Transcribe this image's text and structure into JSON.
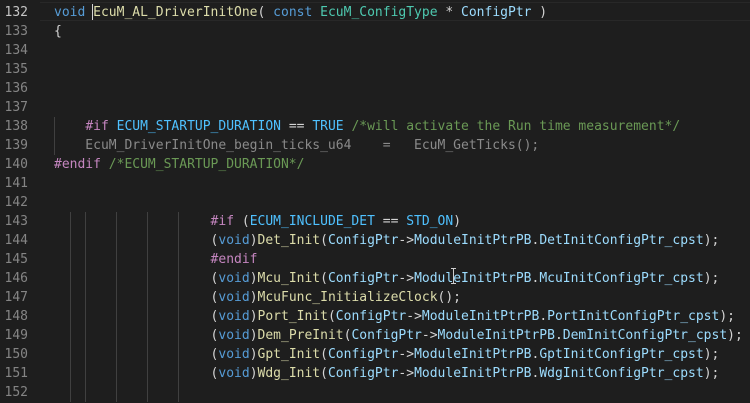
{
  "editor": {
    "active_line": "132",
    "lines": [
      {
        "num": "132",
        "tokens": [
          {
            "t": "void",
            "c": "kw"
          },
          {
            "t": " ",
            "c": "plain"
          },
          {
            "t": "EcuM_AL_DriverInitOne",
            "c": "fn"
          },
          {
            "t": "( ",
            "c": "plain"
          },
          {
            "t": "const",
            "c": "kw"
          },
          {
            "t": " ",
            "c": "plain"
          },
          {
            "t": "EcuM_ConfigType",
            "c": "ty"
          },
          {
            "t": " * ",
            "c": "plain"
          },
          {
            "t": "ConfigPtr",
            "c": "pm"
          },
          {
            "t": " )",
            "c": "plain"
          }
        ]
      },
      {
        "num": "133",
        "tokens": [
          {
            "t": "{",
            "c": "plain"
          }
        ]
      },
      {
        "num": "134",
        "tokens": []
      },
      {
        "num": "135",
        "tokens": []
      },
      {
        "num": "136",
        "tokens": []
      },
      {
        "num": "137",
        "tokens": []
      },
      {
        "num": "138",
        "tokens": [
          {
            "t": "    ",
            "c": "plain"
          },
          {
            "t": "#if",
            "c": "pp"
          },
          {
            "t": " ",
            "c": "plain"
          },
          {
            "t": "ECUM_STARTUP_DURATION",
            "c": "mac"
          },
          {
            "t": " == ",
            "c": "plain"
          },
          {
            "t": "TRUE",
            "c": "mac"
          },
          {
            "t": " ",
            "c": "plain"
          },
          {
            "t": "/*will activate the Run time measurement*/",
            "c": "cm"
          }
        ]
      },
      {
        "num": "139",
        "tokens": [
          {
            "t": "    EcuM_DriverInitOne_begin_ticks_u64    =   EcuM_GetTicks();",
            "c": "inact"
          }
        ]
      },
      {
        "num": "140",
        "tokens": [
          {
            "t": "#endif",
            "c": "pp"
          },
          {
            "t": " ",
            "c": "plain"
          },
          {
            "t": "/*ECUM_STARTUP_DURATION*/",
            "c": "cm"
          }
        ]
      },
      {
        "num": "141",
        "tokens": []
      },
      {
        "num": "142",
        "tokens": []
      },
      {
        "num": "143",
        "tokens": [
          {
            "t": "                    ",
            "c": "plain"
          },
          {
            "t": "#if",
            "c": "pp"
          },
          {
            "t": " (",
            "c": "plain"
          },
          {
            "t": "ECUM_INCLUDE_DET",
            "c": "mac"
          },
          {
            "t": " == ",
            "c": "plain"
          },
          {
            "t": "STD_ON",
            "c": "mac"
          },
          {
            "t": ")",
            "c": "plain"
          }
        ]
      },
      {
        "num": "144",
        "tokens": [
          {
            "t": "                    (",
            "c": "plain"
          },
          {
            "t": "void",
            "c": "kw"
          },
          {
            "t": ")",
            "c": "plain"
          },
          {
            "t": "Det_Init",
            "c": "fn"
          },
          {
            "t": "(",
            "c": "plain"
          },
          {
            "t": "ConfigPtr",
            "c": "pm"
          },
          {
            "t": "->",
            "c": "plain"
          },
          {
            "t": "ModuleInitPtrPB",
            "c": "pm"
          },
          {
            "t": ".",
            "c": "plain"
          },
          {
            "t": "DetInitConfigPtr_cpst",
            "c": "pm"
          },
          {
            "t": ");",
            "c": "plain"
          }
        ]
      },
      {
        "num": "145",
        "tokens": [
          {
            "t": "                    ",
            "c": "plain"
          },
          {
            "t": "#endif",
            "c": "pp"
          }
        ]
      },
      {
        "num": "146",
        "tokens": [
          {
            "t": "                    (",
            "c": "plain"
          },
          {
            "t": "void",
            "c": "kw"
          },
          {
            "t": ")",
            "c": "plain"
          },
          {
            "t": "Mcu_Init",
            "c": "fn"
          },
          {
            "t": "(",
            "c": "plain"
          },
          {
            "t": "ConfigPtr",
            "c": "pm"
          },
          {
            "t": "->",
            "c": "plain"
          },
          {
            "t": "ModuleInitPtrPB",
            "c": "pm"
          },
          {
            "t": ".",
            "c": "plain"
          },
          {
            "t": "McuInitConfigPtr_cpst",
            "c": "pm"
          },
          {
            "t": ");",
            "c": "plain"
          }
        ]
      },
      {
        "num": "147",
        "tokens": [
          {
            "t": "                    (",
            "c": "plain"
          },
          {
            "t": "void",
            "c": "kw"
          },
          {
            "t": ")",
            "c": "plain"
          },
          {
            "t": "McuFunc_InitializeClock",
            "c": "fn"
          },
          {
            "t": "();",
            "c": "plain"
          }
        ]
      },
      {
        "num": "148",
        "tokens": [
          {
            "t": "                    (",
            "c": "plain"
          },
          {
            "t": "void",
            "c": "kw"
          },
          {
            "t": ")",
            "c": "plain"
          },
          {
            "t": "Port_Init",
            "c": "fn"
          },
          {
            "t": "(",
            "c": "plain"
          },
          {
            "t": "ConfigPtr",
            "c": "pm"
          },
          {
            "t": "->",
            "c": "plain"
          },
          {
            "t": "ModuleInitPtrPB",
            "c": "pm"
          },
          {
            "t": ".",
            "c": "plain"
          },
          {
            "t": "PortInitConfigPtr_cpst",
            "c": "pm"
          },
          {
            "t": ");",
            "c": "plain"
          }
        ]
      },
      {
        "num": "149",
        "tokens": [
          {
            "t": "                    (",
            "c": "plain"
          },
          {
            "t": "void",
            "c": "kw"
          },
          {
            "t": ")",
            "c": "plain"
          },
          {
            "t": "Dem_PreInit",
            "c": "fn"
          },
          {
            "t": "(",
            "c": "plain"
          },
          {
            "t": "ConfigPtr",
            "c": "pm"
          },
          {
            "t": "->",
            "c": "plain"
          },
          {
            "t": "ModuleInitPtrPB",
            "c": "pm"
          },
          {
            "t": ".",
            "c": "plain"
          },
          {
            "t": "DemInitConfigPtr_cpst",
            "c": "pm"
          },
          {
            "t": ");",
            "c": "plain"
          }
        ]
      },
      {
        "num": "150",
        "tokens": [
          {
            "t": "                    (",
            "c": "plain"
          },
          {
            "t": "void",
            "c": "kw"
          },
          {
            "t": ")",
            "c": "plain"
          },
          {
            "t": "Gpt_Init",
            "c": "fn"
          },
          {
            "t": "(",
            "c": "plain"
          },
          {
            "t": "ConfigPtr",
            "c": "pm"
          },
          {
            "t": "->",
            "c": "plain"
          },
          {
            "t": "ModuleInitPtrPB",
            "c": "pm"
          },
          {
            "t": ".",
            "c": "plain"
          },
          {
            "t": "GptInitConfigPtr_cpst",
            "c": "pm"
          },
          {
            "t": ");",
            "c": "plain"
          }
        ]
      },
      {
        "num": "151",
        "tokens": [
          {
            "t": "                    (",
            "c": "plain"
          },
          {
            "t": "void",
            "c": "kw"
          },
          {
            "t": ")",
            "c": "plain"
          },
          {
            "t": "Wdg_Init",
            "c": "fn"
          },
          {
            "t": "(",
            "c": "plain"
          },
          {
            "t": "ConfigPtr",
            "c": "pm"
          },
          {
            "t": "->",
            "c": "plain"
          },
          {
            "t": "ModuleInitPtrPB",
            "c": "pm"
          },
          {
            "t": ".",
            "c": "plain"
          },
          {
            "t": "WdgInitConfigPtr_cpst",
            "c": "pm"
          },
          {
            "t": ");",
            "c": "plain"
          }
        ]
      },
      {
        "num": "152",
        "tokens": []
      }
    ]
  },
  "colors": {
    "background": "#1e1e1e",
    "keyword": "#569cd6",
    "function": "#dcdcaa",
    "type": "#4ec9b0",
    "parameter": "#9cdcfe",
    "macro": "#4fc1ff",
    "preprocessor": "#c586c0",
    "comment": "#6a9955",
    "inactive": "#8a8a8a",
    "line_number": "#858585"
  }
}
